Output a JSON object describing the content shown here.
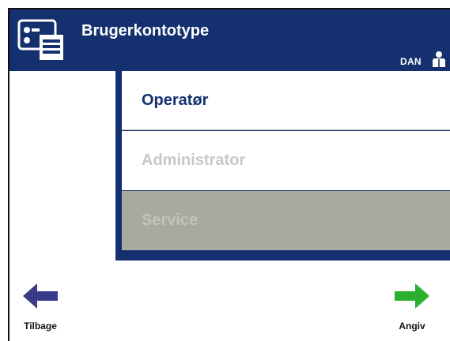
{
  "header": {
    "title": "Brugerkontotype",
    "language": "DAN",
    "colors": {
      "header_bg": "#14306f",
      "accent_green": "#2bb02b",
      "accent_purple": "#3b3a8a"
    },
    "icons": {
      "title": "account-type-icon",
      "user": "user-icon"
    }
  },
  "account_types": [
    {
      "label": "Operatør",
      "state": "selected"
    },
    {
      "label": "Administrator",
      "state": "disabled"
    },
    {
      "label": "Service",
      "state": "disabled"
    }
  ],
  "footer": {
    "back_label": "Tilbage",
    "forward_label": "Angiv",
    "icons": {
      "back": "arrow-left-icon",
      "forward": "arrow-right-icon"
    }
  }
}
